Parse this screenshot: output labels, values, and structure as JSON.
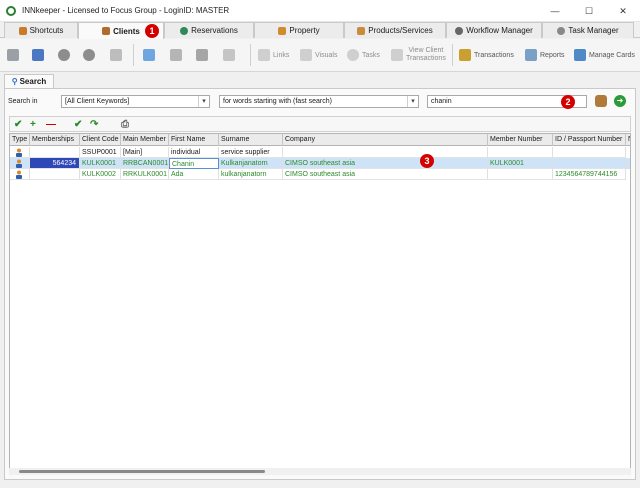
{
  "window": {
    "title": "INNkeeper - Licensed to Focus Group - LoginID: MASTER",
    "controls": [
      "—",
      "☐",
      "✕"
    ]
  },
  "tabs": [
    {
      "label": "Shortcuts",
      "icon": "pencil-icon"
    },
    {
      "label": "Clients",
      "icon": "people-icon",
      "active": true
    },
    {
      "label": "Reservations",
      "icon": "globe-icon"
    },
    {
      "label": "Property",
      "icon": "house-icon"
    },
    {
      "label": "Products/Services",
      "icon": "box-icon"
    },
    {
      "label": "Workflow Manager",
      "icon": "gear-icon"
    },
    {
      "label": "Task Manager",
      "icon": "clock-icon"
    }
  ],
  "toolbar": {
    "links": "Links",
    "visuals": "Visuals",
    "tasks": "Tasks",
    "view_client_1": "View Client",
    "view_client_2": "Transactions",
    "transactions": "Transactions",
    "reports": "Reports",
    "manage_cards": "Manage Cards"
  },
  "search": {
    "tab_label": "Search",
    "search_in_label": "Search in",
    "scope": "[All Client Keywords]",
    "mode": "for words starting with (fast search)",
    "query": "chanin"
  },
  "annotations": [
    "1",
    "2",
    "3"
  ],
  "grid": {
    "columns": [
      "Type",
      "Memberships",
      "Client Code",
      "Main Member",
      "First Name",
      "Surname",
      "Company",
      "Member Number",
      "ID / Passport Number",
      "N"
    ],
    "rows": [
      {
        "memberships": "",
        "client_code": "SSUP0001",
        "main_member": "[Main]",
        "first_name": "individual",
        "surname": "service supplier",
        "company": "",
        "member_number": "",
        "id_passport": ""
      },
      {
        "memberships": "564234",
        "client_code": "KULK0001",
        "main_member": "RRBCAN0001",
        "first_name": "Chanin",
        "surname": "Kulkanjanatorn",
        "company": "CIMSO southeast asia",
        "member_number": "KULK0001",
        "id_passport": ""
      },
      {
        "memberships": "",
        "client_code": "KULK0002",
        "main_member": "RRKULK0001",
        "first_name": "Ada",
        "surname": "kulkanjanatorn",
        "company": "CIMSO southeast asia",
        "member_number": "",
        "id_passport": "1234564789744156"
      }
    ]
  },
  "colors": {
    "accent_green": "#2a8a2a",
    "selection": "#cfe3f8",
    "membership_fill": "#2f48b8",
    "badge_red": "#d40000"
  }
}
